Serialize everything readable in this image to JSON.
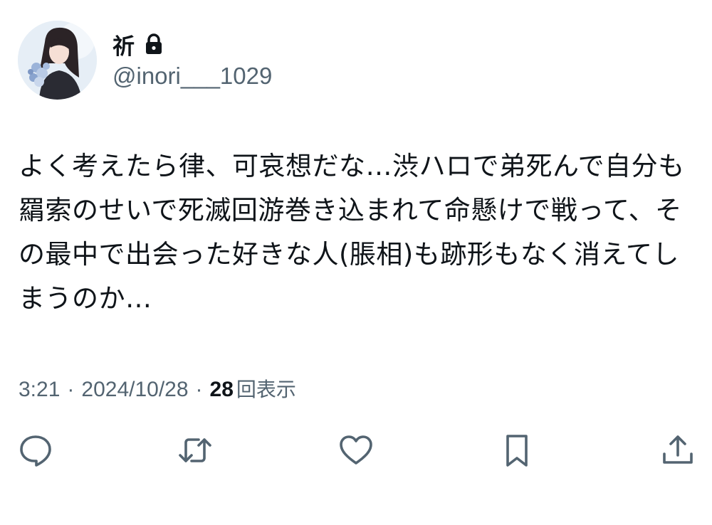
{
  "user": {
    "display_name": "祈",
    "handle": "@inori___1029",
    "protected_icon": "lock-icon"
  },
  "tweet": {
    "text": "よく考えたら律、可哀想だな…渋ハロで弟死んで自分も羂索のせいで死滅回游巻き込まれて命懸けで戦って、その最中で出会った好きな人(脹相)も跡形もなく消えてしまうのか…"
  },
  "meta": {
    "time": "3:21",
    "separator": "·",
    "date": "2024/10/28",
    "views_count": "28",
    "views_label": "回表示"
  },
  "actions": {
    "reply": "reply-icon",
    "retweet": "retweet-icon",
    "like": "heart-icon",
    "bookmark": "bookmark-icon",
    "share": "share-icon"
  },
  "colors": {
    "text_primary": "#0f1419",
    "text_secondary": "#536471"
  }
}
